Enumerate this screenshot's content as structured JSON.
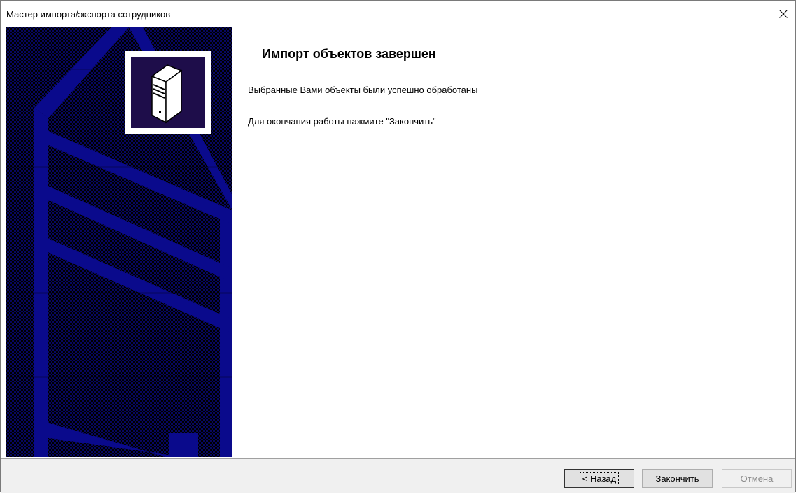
{
  "window": {
    "title": "Мастер импорта/экспорта сотрудников"
  },
  "icons": {
    "close": "close-icon",
    "logo": "server-tower-icon"
  },
  "colors": {
    "sidebar_blue": "#0a0a8c",
    "sidebar_dark": "#05053c",
    "logo_bg": "#1e0d4a",
    "footer_bg": "#f0f0f0"
  },
  "content": {
    "heading": "Импорт объектов завершен",
    "line1": "Выбранные Вами объекты были успешно обработаны",
    "line2": "Для окончания работы нажмите \"Закончить\""
  },
  "buttons": {
    "back": {
      "prefix": "< ",
      "mnemonic": "Н",
      "rest": "азад"
    },
    "finish": {
      "mnemonic": "З",
      "rest": "акончить"
    },
    "cancel": {
      "mnemonic": "О",
      "rest": "тмена"
    }
  }
}
